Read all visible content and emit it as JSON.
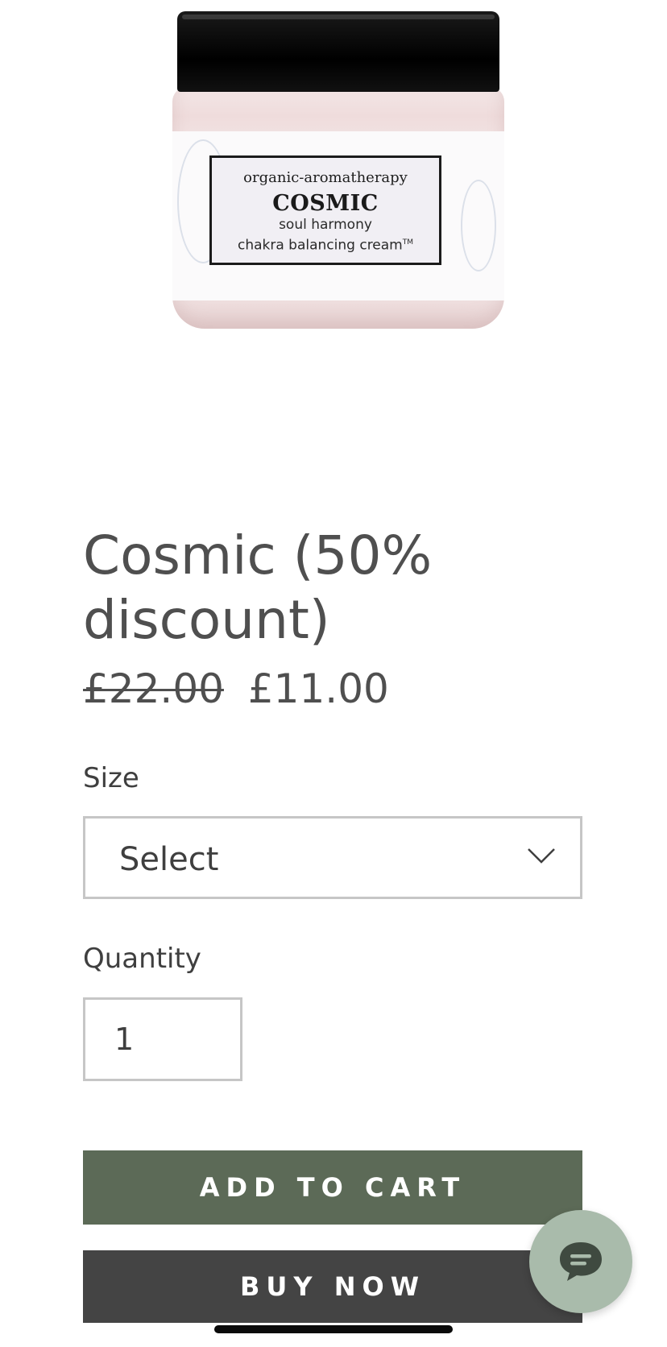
{
  "product_image": {
    "label_brand": "organic-aromatherapy",
    "label_name": "COSMIC",
    "label_line1": "soul harmony",
    "label_line2": "chakra balancing cream",
    "label_trademark": "TM"
  },
  "product": {
    "title": "Cosmic (50% discount)",
    "price_original": "£22.00",
    "price_sale": "£11.00"
  },
  "size": {
    "label": "Size",
    "selected": "Select"
  },
  "quantity": {
    "label": "Quantity",
    "value": "1"
  },
  "buttons": {
    "add_to_cart": "ADD TO CART",
    "buy_now": "BUY NOW"
  },
  "colors": {
    "add_to_cart_bg": "#5c6a57",
    "buy_now_bg": "#444444",
    "chat_bg": "#a9bbab"
  },
  "icons": {
    "chevron": "chevron-down-icon",
    "chat": "chat-icon"
  }
}
